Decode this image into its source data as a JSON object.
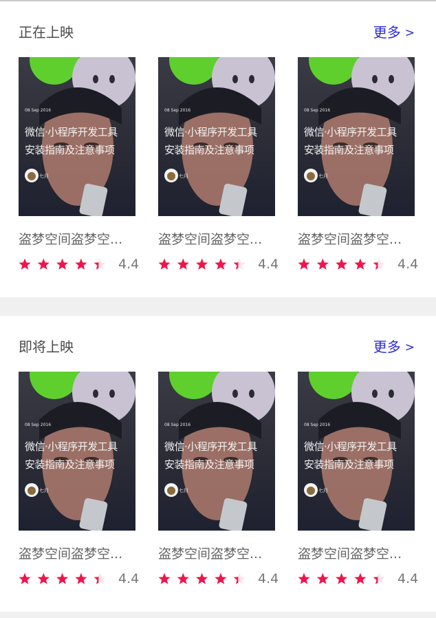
{
  "sections": [
    {
      "title": "正在上映",
      "more_label": "更多",
      "movies": [
        {
          "title": "盗梦空间盗梦空...",
          "score": "4.4",
          "rating": 4.4,
          "poster": {
            "date": "08 Sep 2016",
            "line1": "微信·小程序开发工具",
            "line2": "安装指南及注意事项",
            "author": "七月"
          }
        },
        {
          "title": "盗梦空间盗梦空...",
          "score": "4.4",
          "rating": 4.4,
          "poster": {
            "date": "08 Sep 2016",
            "line1": "微信·小程序开发工具",
            "line2": "安装指南及注意事项",
            "author": "七月"
          }
        },
        {
          "title": "盗梦空间盗梦空...",
          "score": "4.4",
          "rating": 4.4,
          "poster": {
            "date": "08 Sep 2016",
            "line1": "微信·小程序开发工具",
            "line2": "安装指南及注意事项",
            "author": "七月"
          }
        }
      ]
    },
    {
      "title": "即将上映",
      "more_label": "更多",
      "movies": [
        {
          "title": "盗梦空间盗梦空...",
          "score": "4.4",
          "rating": 4.4,
          "poster": {
            "date": "08 Sep 2016",
            "line1": "微信·小程序开发工具",
            "line2": "安装指南及注意事项",
            "author": "七月"
          }
        },
        {
          "title": "盗梦空间盗梦空...",
          "score": "4.4",
          "rating": 4.4,
          "poster": {
            "date": "08 Sep 2016",
            "line1": "微信·小程序开发工具",
            "line2": "安装指南及注意事项",
            "author": "七月"
          }
        },
        {
          "title": "盗梦空间盗梦空...",
          "score": "4.4",
          "rating": 4.4,
          "poster": {
            "date": "08 Sep 2016",
            "line1": "微信·小程序开发工具",
            "line2": "安装指南及注意事项",
            "author": "七月"
          }
        }
      ]
    }
  ],
  "icons": {
    "more": "chevron-right-icon",
    "star": "star-icon",
    "poster_avatar": "avatar-icon"
  },
  "colors": {
    "star_filled": "#f0144b",
    "star_empty": "#fde3ea",
    "more_link": "#2a2ad8",
    "divider": "#f0f0f0"
  }
}
